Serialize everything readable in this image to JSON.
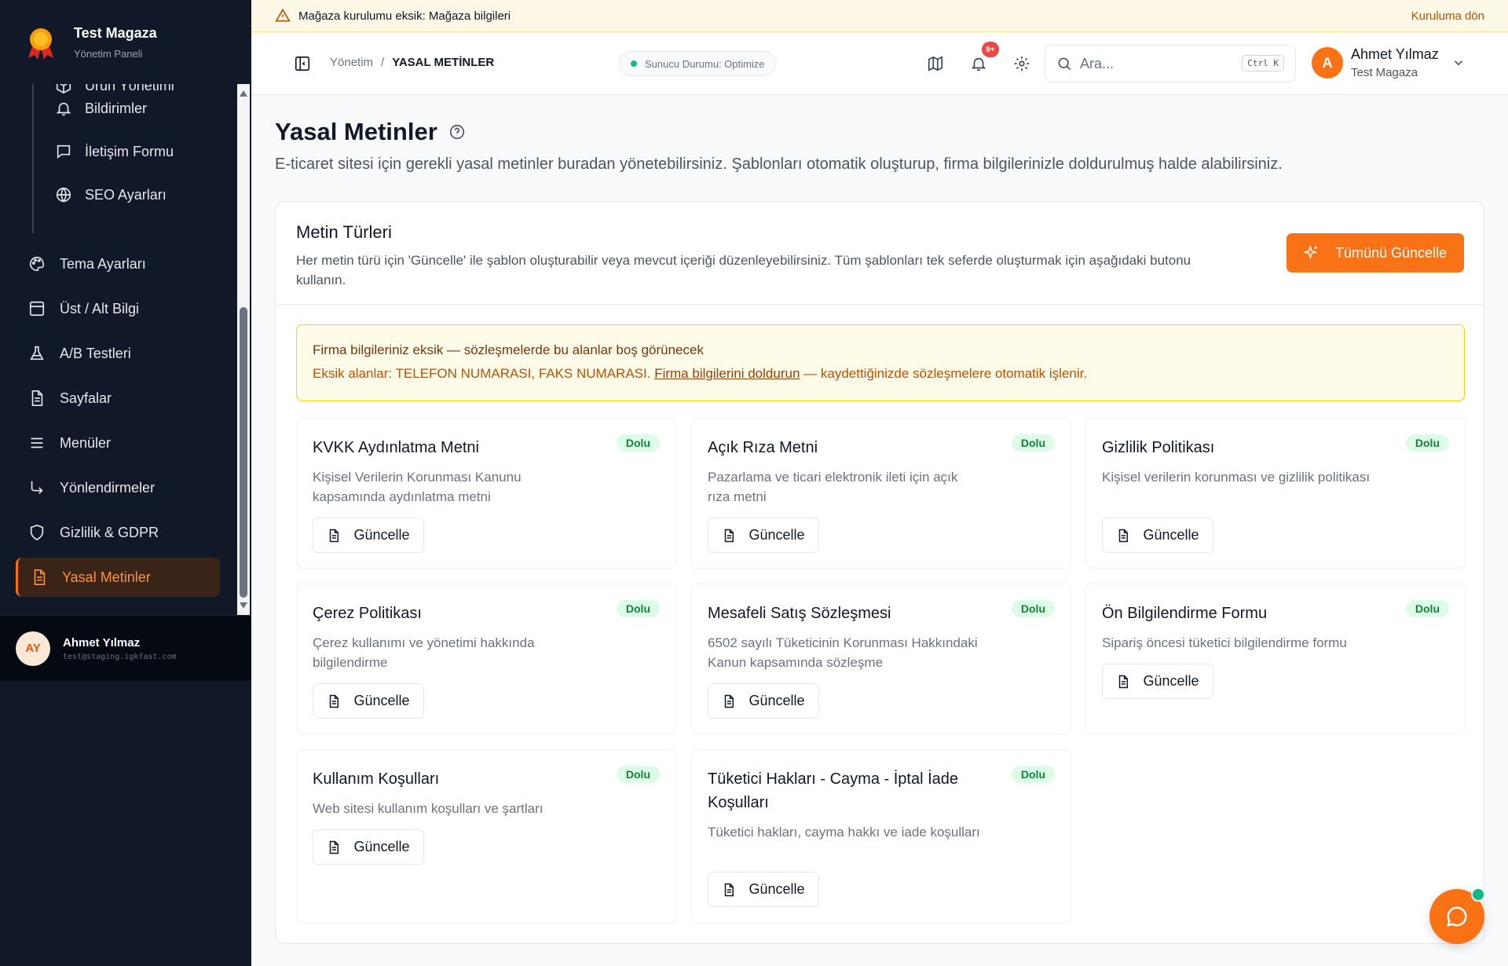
{
  "brand": {
    "title": "Test Magaza",
    "subtitle": "Yönetim Paneli"
  },
  "sidebar": {
    "sub_items": [
      {
        "label": "Ürün Yönetimi",
        "icon": "box-icon"
      },
      {
        "label": "Bildirimler",
        "icon": "bell-icon"
      },
      {
        "label": "İletişim Formu",
        "icon": "message-icon"
      },
      {
        "label": "SEO Ayarları",
        "icon": "globe-icon"
      }
    ],
    "items": [
      {
        "label": "Tema Ayarları",
        "icon": "palette-icon"
      },
      {
        "label": "Üst / Alt Bilgi",
        "icon": "layout-icon"
      },
      {
        "label": "A/B Testleri",
        "icon": "flask-icon"
      },
      {
        "label": "Sayfalar",
        "icon": "file-icon"
      },
      {
        "label": "Menüler",
        "icon": "menu-icon"
      },
      {
        "label": "Yönlendirmeler",
        "icon": "redirect-icon"
      },
      {
        "label": "Gizlilik & GDPR",
        "icon": "shield-icon"
      },
      {
        "label": "Yasal Metinler",
        "icon": "document-icon",
        "active": true
      }
    ],
    "user": {
      "initials": "AY",
      "name": "Ahmet Yılmaz",
      "email": "test@staging.igkfast.com"
    }
  },
  "banner": {
    "text_prefix": "Mağaza kurulumu eksik:",
    "text_link": "Mağaza bilgileri",
    "action": "Kuruluma dön"
  },
  "header": {
    "breadcrumb": [
      "Yönetim",
      "/",
      "YASAL METİNLER"
    ],
    "status": "Sunucu Durumu: Optimize",
    "notif_badge": "9+",
    "search_placeholder": "Ara...",
    "search_shortcut": "Ctrl K",
    "user": {
      "initial": "A",
      "name": "Ahmet Yılmaz",
      "store": "Test Magaza"
    }
  },
  "page": {
    "title": "Yasal Metinler",
    "subtitle": "E-ticaret sitesi için gerekli yasal metinler buradan yönetebilirsiniz. Şablonları otomatik oluşturup, firma bilgilerinizle doldurulmuş halde alabilirsiniz."
  },
  "types": {
    "title": "Metin Türleri",
    "description": "Her metin türü için 'Güncelle' ile şablon oluşturabilir veya mevcut içeriği düzenleyebilirsiniz. Tüm şablonları tek seferde oluşturmak için aşağıdaki butonu kullanın.",
    "update_all": "Tümünü Güncelle"
  },
  "warning": {
    "title": "Firma bilgileriniz eksik — sözleşmelerde bu alanlar boş görünecek",
    "text_prefix": "Eksik alanlar: TELEFON NUMARASI, FAKS NUMARASI.",
    "link": "Firma bilgilerini doldurun",
    "text_suffix": "— kaydettiğinizde sözleşmelere otomatik işlenir."
  },
  "legal_cards": [
    {
      "title": "KVKK Aydınlatma Metni",
      "badge": "Dolu",
      "desc": "Kişisel Verilerin Korunması Kanunu kapsamında aydınlatma metni",
      "button": "Güncelle"
    },
    {
      "title": "Açık Rıza Metni",
      "badge": "Dolu",
      "desc": "Pazarlama ve ticari elektronik ileti için açık rıza metni",
      "button": "Güncelle"
    },
    {
      "title": "Gizlilik Politikası",
      "badge": "Dolu",
      "desc": "Kişisel verilerin korunması ve gizlilik politikası",
      "button": "Güncelle"
    },
    {
      "title": "Çerez Politikası",
      "badge": "Dolu",
      "desc": "Çerez kullanımı ve yönetimi hakkında bilgilendirme",
      "button": "Güncelle"
    },
    {
      "title": "Mesafeli Satış Sözleşmesi",
      "badge": "Dolu",
      "desc": "6502 sayılı Tüketicinin Korunması Hakkındaki Kanun kapsamında sözleşme",
      "button": "Güncelle"
    },
    {
      "title": "Ön Bilgilendirme Formu",
      "badge": "Dolu",
      "desc": "Sipariş öncesi tüketici bilgilendirme formu",
      "button": "Güncelle"
    },
    {
      "title": "Kullanım Koşulları",
      "badge": "Dolu",
      "desc": "Web sitesi kullanım koşulları ve şartları",
      "button": "Güncelle"
    },
    {
      "title": "Tüketici Hakları - Cayma - İptal İade Koşulları",
      "badge": "Dolu",
      "desc": "Tüketici hakları, cayma hakkı ve iade koşulları",
      "button": "Güncelle"
    }
  ],
  "colors": {
    "accent": "#f97316",
    "sidebar_bg": "#111827",
    "success": "#15803d"
  }
}
